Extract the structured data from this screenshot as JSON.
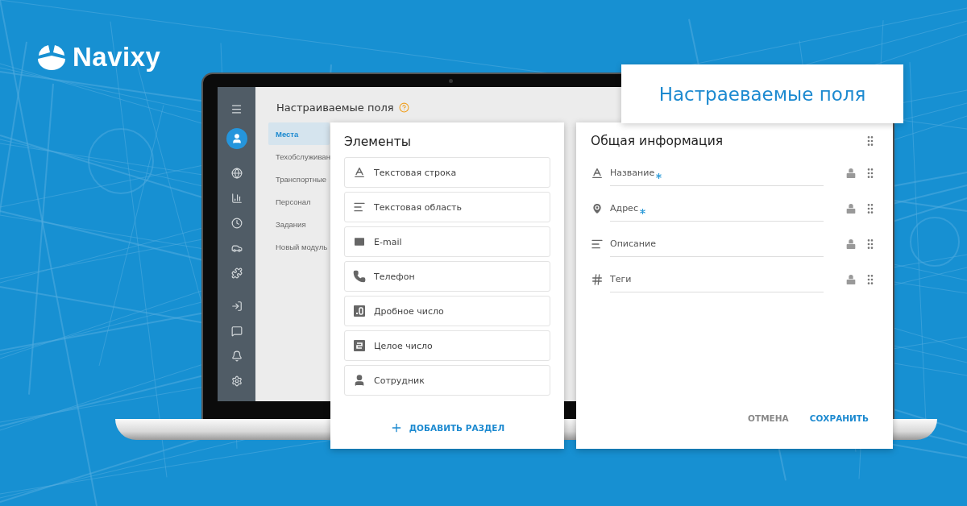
{
  "brand": {
    "name": "Navixy"
  },
  "banner_title": "Настраеваемые поля",
  "app": {
    "page_title": "Настраиваемые поля",
    "nav": [
      {
        "label": "Места",
        "selected": true
      },
      {
        "label": "Техобслуживан",
        "selected": false
      },
      {
        "label": "Транспортные",
        "selected": false
      },
      {
        "label": "Персонал",
        "selected": false
      },
      {
        "label": "Задания",
        "selected": false
      },
      {
        "label": "Новый модуль",
        "selected": false
      }
    ]
  },
  "elements_panel": {
    "title": "Элементы",
    "items": [
      {
        "label": "Текстовая строка",
        "kind": "text_line"
      },
      {
        "label": "Текстовая область",
        "kind": "text_area"
      },
      {
        "label": "E-mail",
        "kind": "email"
      },
      {
        "label": "Телефон",
        "kind": "phone"
      },
      {
        "label": "Дробное число",
        "kind": "decimal"
      },
      {
        "label": "Целое число",
        "kind": "integer"
      },
      {
        "label": "Сотрудник",
        "kind": "employee"
      }
    ],
    "add_button": "ДОБАВИТЬ РАЗДЕЛ"
  },
  "form_panel": {
    "title": "Общая информация",
    "fields": [
      {
        "label": "Название",
        "kind": "text_line",
        "required": true
      },
      {
        "label": "Адрес",
        "kind": "location",
        "required": true
      },
      {
        "label": "Описание",
        "kind": "text_area",
        "required": false
      },
      {
        "label": "Теги",
        "kind": "tag",
        "required": false
      }
    ],
    "buttons": [
      {
        "label": "ОТМЕНА",
        "kind": "secondary"
      },
      {
        "label": "СОХРАНИТЬ",
        "kind": "primary"
      }
    ]
  }
}
